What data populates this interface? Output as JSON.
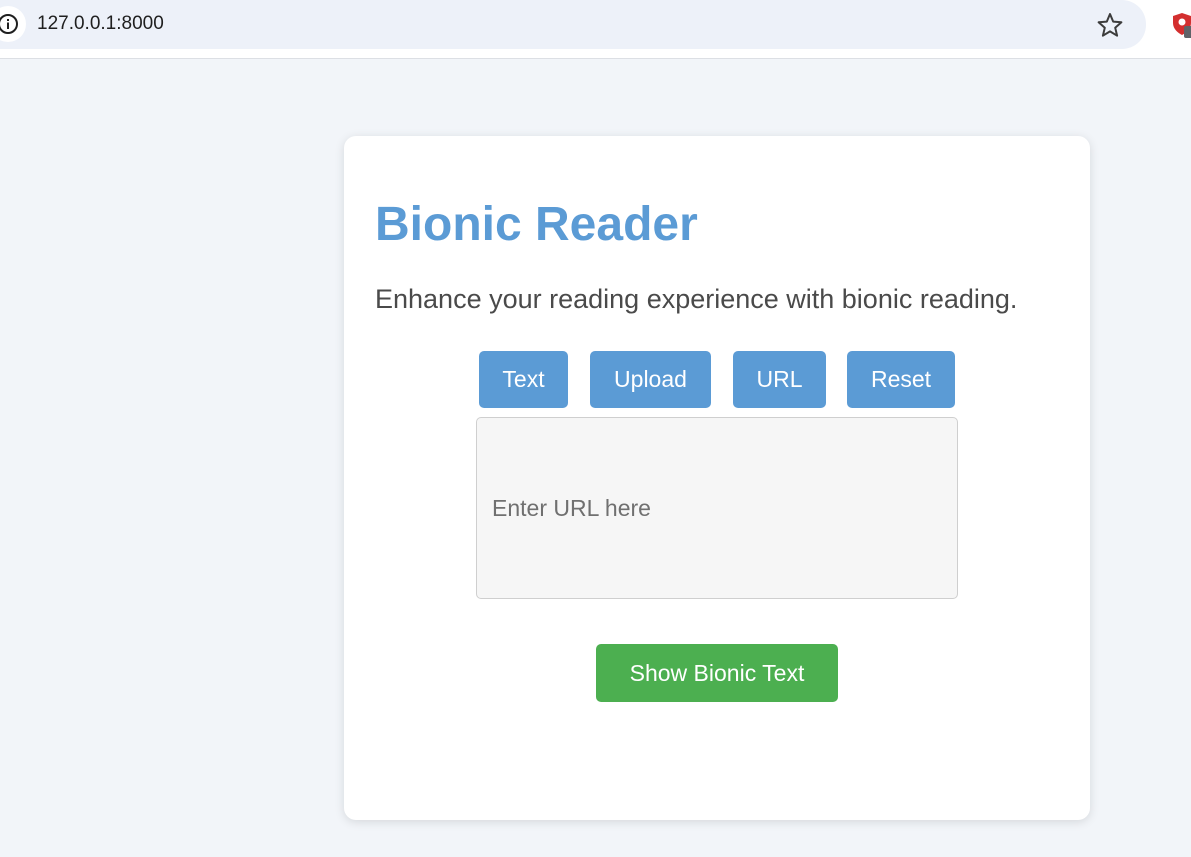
{
  "browser": {
    "url": "127.0.0.1:8000",
    "info_icon": "info-icon",
    "bookmark_icon": "star-icon",
    "extension_icon": "shield-extension-icon"
  },
  "app": {
    "title": "Bionic Reader",
    "subtitle": "Enhance your reading experience with bionic reading."
  },
  "mode_buttons": {
    "text": "Text",
    "upload": "Upload",
    "url": "URL",
    "reset": "Reset"
  },
  "url_input": {
    "value": "",
    "placeholder": "Enter URL here"
  },
  "actions": {
    "show_bionic_text": "Show Bionic Text"
  },
  "colors": {
    "accent_blue": "#5b9bd5",
    "primary_green": "#4caf50",
    "page_background": "#f2f5f9"
  }
}
